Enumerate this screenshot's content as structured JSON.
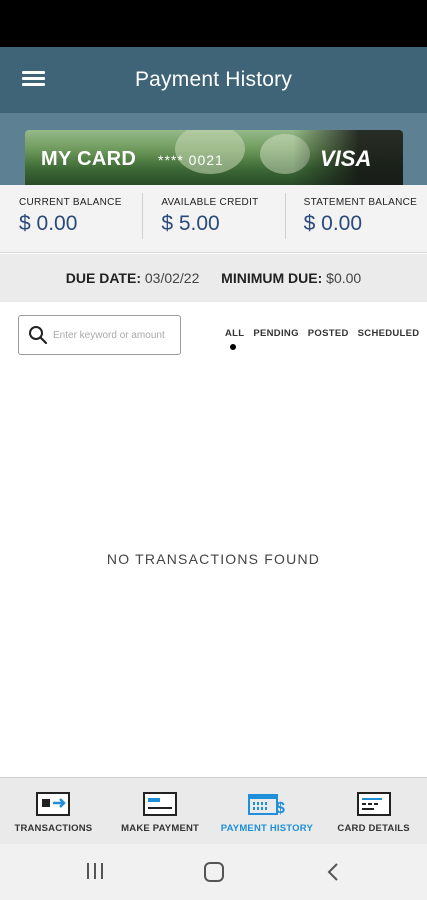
{
  "header": {
    "title": "Payment History",
    "menu_icon": "hamburger-menu-icon"
  },
  "card": {
    "name": "MY CARD",
    "number": "**** 0021",
    "brand": "VISA"
  },
  "balances": [
    {
      "label": "CURRENT BALANCE",
      "value": "$ 0.00"
    },
    {
      "label": "AVAILABLE CREDIT",
      "value": "$ 5.00"
    },
    {
      "label": "STATEMENT BALANCE",
      "value": "$ 0.00"
    }
  ],
  "due": {
    "date_label": "DUE DATE:",
    "date_value": "03/02/22",
    "min_label": "MINIMUM DUE:",
    "min_value": "$0.00"
  },
  "search": {
    "placeholder": "Enter keyword or amount",
    "value": ""
  },
  "filters": {
    "items": [
      "ALL",
      "PENDING",
      "POSTED",
      "SCHEDULED"
    ],
    "selected": "ALL"
  },
  "empty_message": "NO TRANSACTIONS FOUND",
  "bottom_nav": {
    "items": [
      {
        "label": "TRANSACTIONS",
        "icon": "transactions-card-icon"
      },
      {
        "label": "MAKE PAYMENT",
        "icon": "make-payment-card-icon"
      },
      {
        "label": "PAYMENT HISTORY",
        "icon": "payment-history-icon"
      },
      {
        "label": "CARD DETAILS",
        "icon": "card-details-icon"
      }
    ],
    "active": "PAYMENT HISTORY"
  },
  "system_nav": {
    "recents_icon": "recent-apps-icon",
    "home_icon": "home-icon",
    "back_icon": "back-icon"
  },
  "colors": {
    "header": "#3f6377",
    "accent": "#1e8fd8",
    "balance_value": "#2a4a7b"
  }
}
